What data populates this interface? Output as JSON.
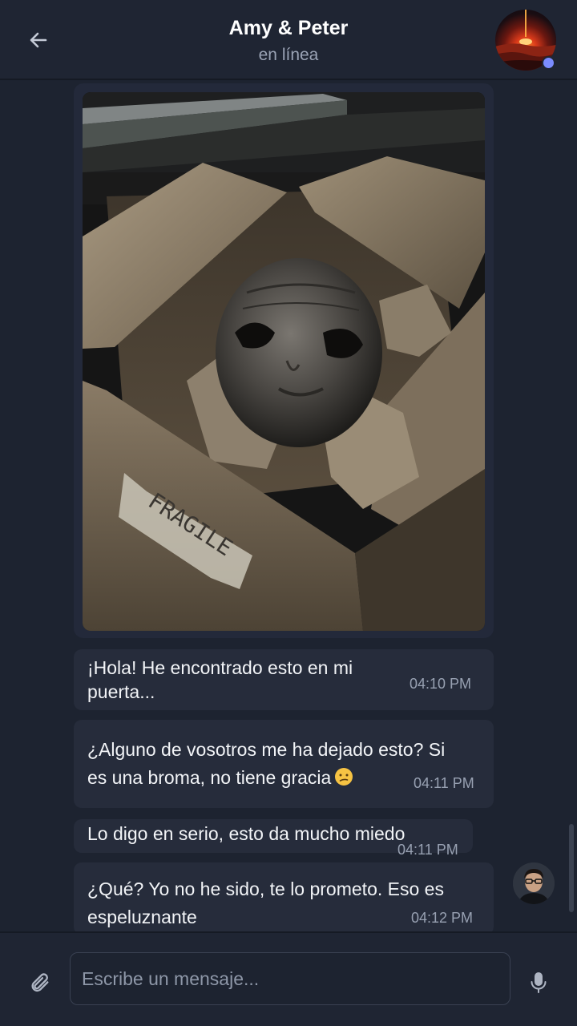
{
  "header": {
    "back_icon": "arrow-left-icon",
    "title": "Amy & Peter",
    "status": "en línea",
    "avatar_icon": "group-avatar",
    "online_color": "#7b8cff"
  },
  "chat": {
    "image_message": {
      "caption_on_box": "FRAGILE",
      "description_icon": "photo-alien-head-in-box"
    },
    "messages": [
      {
        "text_line1": "¡Hola! He encontrado esto en mi",
        "text_line2": "puerta...",
        "time": "04:10 PM"
      },
      {
        "text_line1": "¿Alguno de vosotros me ha dejado esto? Si",
        "text_line2": "es una broma, no tiene gracia",
        "emoji": "😕",
        "time": "04:11 PM"
      },
      {
        "text_line1": "Lo digo en serio, esto da mucho miedo",
        "time": "04:11 PM"
      },
      {
        "text_line1": "¿Qué? Yo no he sido, te lo prometo. Eso es",
        "text_line2": "espeluznante",
        "time": "04:12 PM"
      }
    ]
  },
  "composer": {
    "attach_icon": "paperclip-icon",
    "placeholder": "Escribe un mensaje...",
    "mic_icon": "microphone-icon"
  },
  "colors": {
    "background": "#1d2330",
    "header": "#1f2533",
    "bubble": "#262c3b",
    "time_text": "#98a1b2"
  }
}
